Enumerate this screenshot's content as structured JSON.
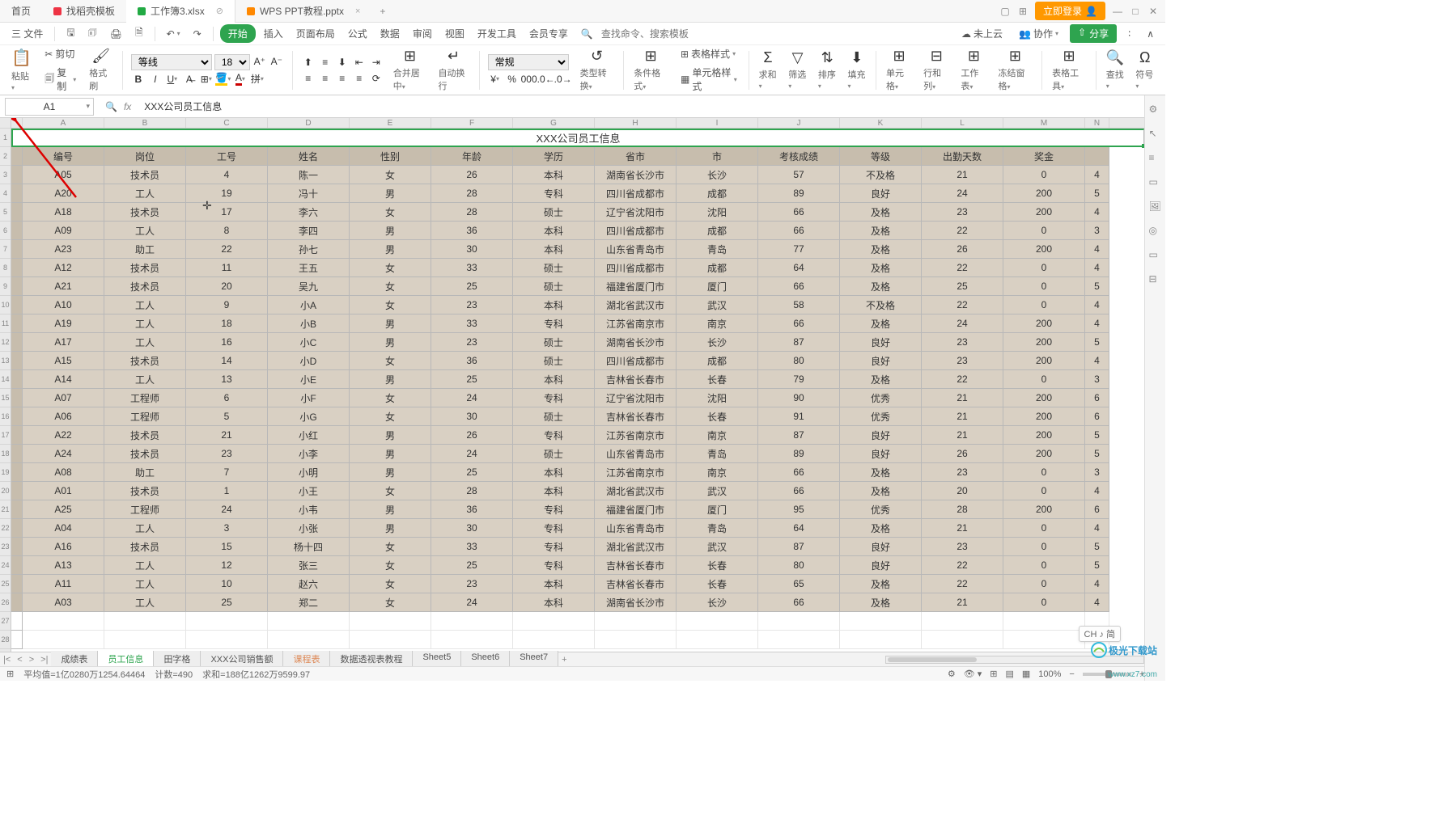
{
  "tabs": {
    "home": "首页",
    "t1": "找稻壳模板",
    "t2": "工作簿3.xlsx",
    "t3": "WPS PPT教程.pptx",
    "login": "立即登录"
  },
  "menu": {
    "file": "三 文件",
    "start": "开始",
    "insert": "插入",
    "layout": "页面布局",
    "formula": "公式",
    "data": "数据",
    "review": "审阅",
    "view": "视图",
    "dev": "开发工具",
    "vip": "会员专享",
    "search_ph": "查找命令、搜索模板",
    "cloud": "未上云",
    "collab": "协作",
    "share": "分享"
  },
  "ribbon": {
    "paste": "粘贴",
    "cut": "剪切",
    "copy": "复制",
    "brush": "格式刷",
    "font": "等线",
    "size": "18",
    "merge": "合并居中",
    "wrap": "自动换行",
    "numfmt": "常规",
    "typecvt": "类型转换",
    "condfmt": "条件格式",
    "tablestyle": "表格样式",
    "cellstyle": "单元格样式",
    "sum": "求和",
    "filter": "筛选",
    "sort": "排序",
    "fill": "填充",
    "cells": "单元格",
    "rowcol": "行和列",
    "sheet": "工作表",
    "freeze": "冻结窗格",
    "tools": "表格工具",
    "find": "查找",
    "symbol": "符号"
  },
  "namebox": "A1",
  "formula": "XXX公司员工信息",
  "grid": {
    "cols": [
      "A",
      "B",
      "C",
      "D",
      "E",
      "F",
      "G",
      "H",
      "I",
      "J",
      "K",
      "L",
      "M",
      "N"
    ],
    "colNarrow": ".",
    "title": "XXX公司员工信息",
    "headers": [
      "编号",
      "岗位",
      "工号",
      "姓名",
      "性别",
      "年龄",
      "学历",
      "省市",
      "市",
      "考核成绩",
      "等级",
      "出勤天数",
      "奖金",
      ""
    ],
    "rows": [
      [
        "A05",
        "技术员",
        "4",
        "陈一",
        "女",
        "26",
        "本科",
        "湖南省长沙市",
        "长沙",
        "57",
        "不及格",
        "21",
        "0",
        "4"
      ],
      [
        "A20",
        "工人",
        "19",
        "冯十",
        "男",
        "28",
        "专科",
        "四川省成都市",
        "成都",
        "89",
        "良好",
        "24",
        "200",
        "5"
      ],
      [
        "A18",
        "技术员",
        "17",
        "李六",
        "女",
        "28",
        "硕士",
        "辽宁省沈阳市",
        "沈阳",
        "66",
        "及格",
        "23",
        "200",
        "4"
      ],
      [
        "A09",
        "工人",
        "8",
        "李四",
        "男",
        "36",
        "本科",
        "四川省成都市",
        "成都",
        "66",
        "及格",
        "22",
        "0",
        "3"
      ],
      [
        "A23",
        "助工",
        "22",
        "孙七",
        "男",
        "30",
        "本科",
        "山东省青岛市",
        "青岛",
        "77",
        "及格",
        "26",
        "200",
        "4"
      ],
      [
        "A12",
        "技术员",
        "11",
        "王五",
        "女",
        "33",
        "硕士",
        "四川省成都市",
        "成都",
        "64",
        "及格",
        "22",
        "0",
        "4"
      ],
      [
        "A21",
        "技术员",
        "20",
        "吴九",
        "女",
        "25",
        "硕士",
        "福建省厦门市",
        "厦门",
        "66",
        "及格",
        "25",
        "0",
        "5"
      ],
      [
        "A10",
        "工人",
        "9",
        "小A",
        "女",
        "23",
        "本科",
        "湖北省武汉市",
        "武汉",
        "58",
        "不及格",
        "22",
        "0",
        "4"
      ],
      [
        "A19",
        "工人",
        "18",
        "小B",
        "男",
        "33",
        "专科",
        "江苏省南京市",
        "南京",
        "66",
        "及格",
        "24",
        "200",
        "4"
      ],
      [
        "A17",
        "工人",
        "16",
        "小C",
        "男",
        "23",
        "硕士",
        "湖南省长沙市",
        "长沙",
        "87",
        "良好",
        "23",
        "200",
        "5"
      ],
      [
        "A15",
        "技术员",
        "14",
        "小D",
        "女",
        "36",
        "硕士",
        "四川省成都市",
        "成都",
        "80",
        "良好",
        "23",
        "200",
        "4"
      ],
      [
        "A14",
        "工人",
        "13",
        "小E",
        "男",
        "25",
        "本科",
        "吉林省长春市",
        "长春",
        "79",
        "及格",
        "22",
        "0",
        "3"
      ],
      [
        "A07",
        "工程师",
        "6",
        "小F",
        "女",
        "24",
        "专科",
        "辽宁省沈阳市",
        "沈阳",
        "90",
        "优秀",
        "21",
        "200",
        "6"
      ],
      [
        "A06",
        "工程师",
        "5",
        "小G",
        "女",
        "30",
        "硕士",
        "吉林省长春市",
        "长春",
        "91",
        "优秀",
        "21",
        "200",
        "6"
      ],
      [
        "A22",
        "技术员",
        "21",
        "小红",
        "男",
        "26",
        "专科",
        "江苏省南京市",
        "南京",
        "87",
        "良好",
        "21",
        "200",
        "5"
      ],
      [
        "A24",
        "技术员",
        "23",
        "小李",
        "男",
        "24",
        "硕士",
        "山东省青岛市",
        "青岛",
        "89",
        "良好",
        "26",
        "200",
        "5"
      ],
      [
        "A08",
        "助工",
        "7",
        "小明",
        "男",
        "25",
        "本科",
        "江苏省南京市",
        "南京",
        "66",
        "及格",
        "23",
        "0",
        "3"
      ],
      [
        "A01",
        "技术员",
        "1",
        "小王",
        "女",
        "28",
        "本科",
        "湖北省武汉市",
        "武汉",
        "66",
        "及格",
        "20",
        "0",
        "4"
      ],
      [
        "A25",
        "工程师",
        "24",
        "小韦",
        "男",
        "36",
        "专科",
        "福建省厦门市",
        "厦门",
        "95",
        "优秀",
        "28",
        "200",
        "6"
      ],
      [
        "A04",
        "工人",
        "3",
        "小张",
        "男",
        "30",
        "专科",
        "山东省青岛市",
        "青岛",
        "64",
        "及格",
        "21",
        "0",
        "4"
      ],
      [
        "A16",
        "技术员",
        "15",
        "杨十四",
        "女",
        "33",
        "专科",
        "湖北省武汉市",
        "武汉",
        "87",
        "良好",
        "23",
        "0",
        "5"
      ],
      [
        "A13",
        "工人",
        "12",
        "张三",
        "女",
        "25",
        "专科",
        "吉林省长春市",
        "长春",
        "80",
        "良好",
        "22",
        "0",
        "5"
      ],
      [
        "A11",
        "工人",
        "10",
        "赵六",
        "女",
        "23",
        "本科",
        "吉林省长春市",
        "长春",
        "65",
        "及格",
        "22",
        "0",
        "4"
      ],
      [
        "A03",
        "工人",
        "25",
        "郑二",
        "女",
        "24",
        "本科",
        "湖南省长沙市",
        "长沙",
        "66",
        "及格",
        "21",
        "0",
        "4"
      ]
    ]
  },
  "sheets": {
    "items": [
      "成绩表",
      "员工信息",
      "田字格",
      "XXX公司销售额",
      "课程表",
      "数据透视表教程",
      "Sheet5",
      "Sheet6",
      "Sheet7"
    ],
    "activeIndex": 1,
    "highlightIndex": 4
  },
  "status": {
    "avg": "平均值=1亿0280万1254.64464",
    "count": "计数=490",
    "sum": "求和=188亿1262万9599.97",
    "zoom": "100%",
    "ch": "CH ♪ 简"
  },
  "watermark": "www.xz7.com",
  "watermark_logo": "极光下载站"
}
